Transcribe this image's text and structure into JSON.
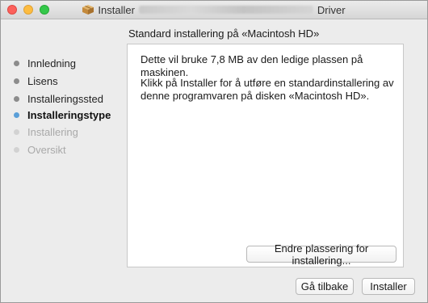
{
  "window": {
    "title_prefix": "Installer",
    "title_suffix": "Driver"
  },
  "section_title": "Standard installering på «Macintosh HD»",
  "sidebar": {
    "steps": [
      {
        "label": "Innledning",
        "state": "done"
      },
      {
        "label": "Lisens",
        "state": "done"
      },
      {
        "label": "Installeringssted",
        "state": "done"
      },
      {
        "label": "Installeringstype",
        "state": "current"
      },
      {
        "label": "Installering",
        "state": "pending"
      },
      {
        "label": "Oversikt",
        "state": "pending"
      }
    ]
  },
  "content": {
    "line1": "Dette vil bruke 7,8 MB av den ledige plassen på maskinen.",
    "line2": "Klikk på Installer for å utføre en standardinstallering av denne programvaren på disken «Macintosh HD».",
    "change_location_button": "Endre plassering for installering..."
  },
  "footer": {
    "back_button": "Gå tilbake",
    "install_button": "Installer"
  },
  "colors": {
    "current_step_dot": "#5a9fd8",
    "close": "#fc605b",
    "minimize": "#fdbc40",
    "zoom": "#34c84a"
  },
  "icons": [
    "package-icon"
  ]
}
